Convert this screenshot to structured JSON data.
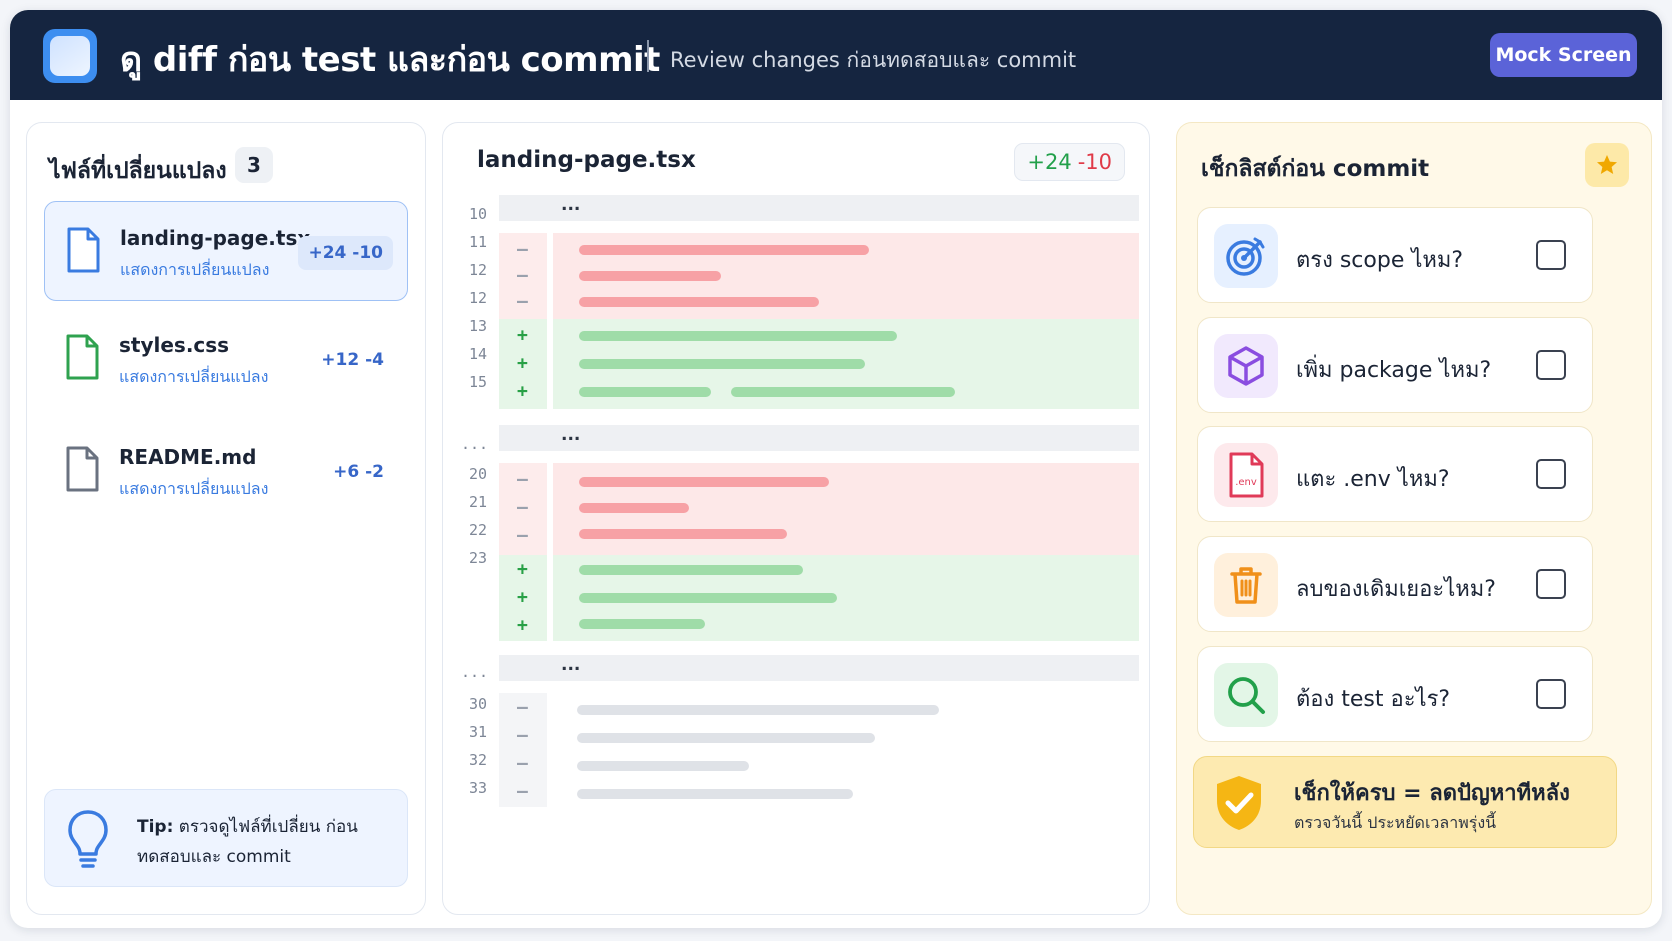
{
  "header": {
    "title": "ดู diff ก่อน test และก่อน commit",
    "subtitle": "Review changes ก่อนทดสอบและ commit",
    "mock_button": "Mock Screen"
  },
  "files_panel": {
    "title": "ไฟล์ที่เปลี่ยนแปลง",
    "count": "3",
    "files": [
      {
        "name": "landing-page.tsx",
        "sub": "แสดงการเปลี่ยนแปลง",
        "stat": "+24 -10",
        "color": "#3a7be0"
      },
      {
        "name": "styles.css",
        "sub": "แสดงการเปลี่ยนแปลง",
        "stat": "+12 -4",
        "color": "#2fa24f"
      },
      {
        "name": "README.md",
        "sub": "แสดงการเปลี่ยนแปลง",
        "stat": "+6 -2",
        "color": "#6a7280"
      }
    ],
    "tip": {
      "label": "Tip:",
      "text": "ตรวจดูไฟล์ที่เปลี่ยน ก่อนทดสอบและ commit"
    }
  },
  "diff_panel": {
    "file": "landing-page.tsx",
    "additions": "+24",
    "deletions": "-10",
    "hunk_marker": "...",
    "line_numbers": [
      "10",
      "11",
      "12",
      "12",
      "13",
      "14",
      "15",
      "...",
      "20",
      "21",
      "22",
      "23",
      "...",
      "30",
      "31",
      "32",
      "33"
    ],
    "signs": {
      "del": "–",
      "add": "+"
    }
  },
  "checklist": {
    "title": "เช็กลิสต์ก่อน commit",
    "items": [
      {
        "label": "ตรง scope ไหม?",
        "icon": "target-icon"
      },
      {
        "label": "เพิ่ม package ไหม?",
        "icon": "package-icon"
      },
      {
        "label": "แตะ .env ไหม?",
        "icon": "env-file-icon"
      },
      {
        "label": "ลบของเดิมเยอะไหม?",
        "icon": "trash-icon"
      },
      {
        "label": "ต้อง test อะไร?",
        "icon": "search-icon"
      }
    ],
    "env_icon_text": ".env",
    "callout": {
      "title": "เช็กให้ครบ = ลดปัญหาทีหลัง",
      "sub": "ตรวจวันนี้ ประหยัดเวลาพรุ่งนี้"
    }
  },
  "colors": {
    "header_bg": "#152540",
    "accent": "#5b63d8",
    "add": "#22a04a",
    "del": "#e03a48",
    "checklist_bg": "#fff9e8"
  }
}
